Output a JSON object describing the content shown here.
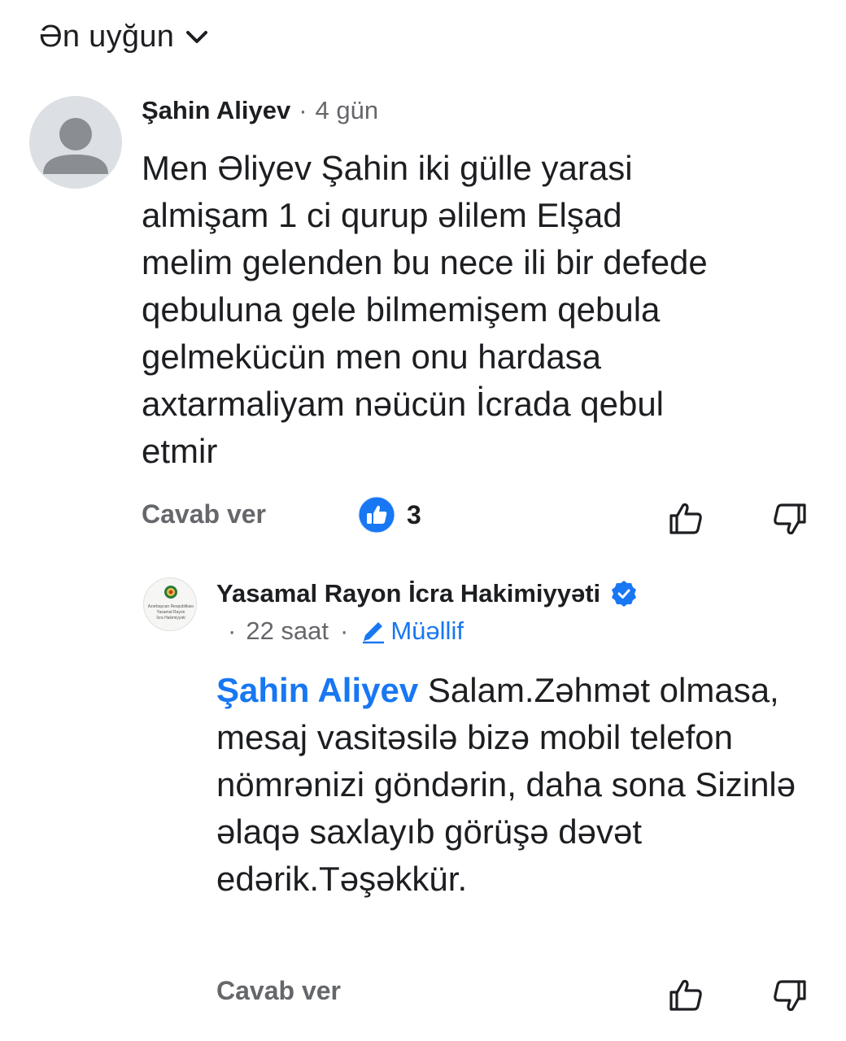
{
  "sort": {
    "label": "Ən uyğun"
  },
  "comment": {
    "author": "Şahin Aliyev",
    "separator": "·",
    "time": "4 gün",
    "text": "Men Əliyev Şahin iki gülle yarasi\nalmişam 1 ci qurup əlilem Elşad\nmelim gelenden bu nece ili bir defede\nqebuluna gele bilmemişem qebula\ngelmekücün men onu hardasa\naxtarmaliyam nəücün İcrada qebul\netmir",
    "reply_label": "Cavab ver",
    "reaction_count": "3"
  },
  "reply": {
    "author": "Yasamal Rayon İcra Hakimiyyəti",
    "separator": "·",
    "time": "22 saat",
    "separator2": "·",
    "author_tag": "Müəllif",
    "mention": "Şahin Aliyev",
    "text": " Salam.Zəhmət olmasa, mesaj vasitəsilə bizə mobil telefon nömrənizi göndərin, daha sona Sizinlə əlaqə saxlayıb görüşə dəvət edərik.Təşəkkür.",
    "logo_text": [
      "Azərbaycan Respublikası",
      "Yasamal Rayon",
      "İcra Hakimiyyəti"
    ],
    "reply_label": "Cavab ver"
  },
  "colors": {
    "accent": "#1877f2",
    "muted": "#65676b",
    "text": "#1c1e21"
  }
}
